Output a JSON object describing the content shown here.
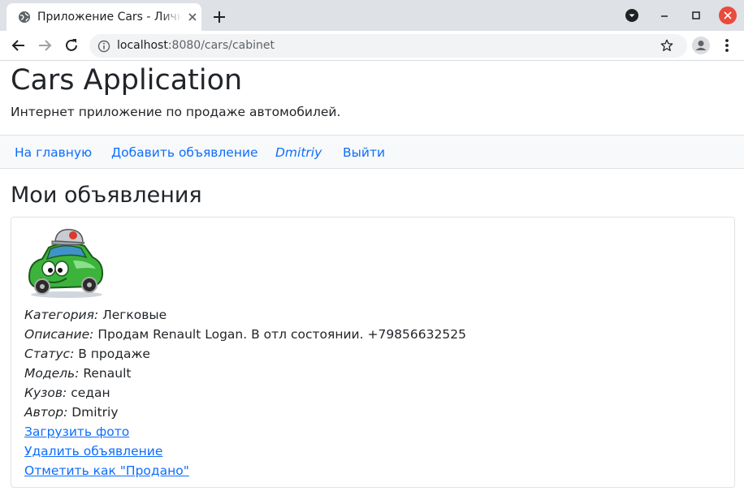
{
  "browser": {
    "tab_title": "Приложение Cars - Личный кабинет",
    "url_host": "localhost",
    "url_rest": ":8080/cars/cabinet"
  },
  "icons": {
    "favicon": "globe-icon",
    "tab_close": "close-icon",
    "new_tab": "plus-icon",
    "back": "arrow-left-icon",
    "forward": "arrow-right-icon",
    "reload": "reload-icon",
    "site_info": "info-icon",
    "bookmark": "star-icon",
    "profile": "profile-icon",
    "menu": "kebab-menu-icon"
  },
  "header": {
    "title": "Cars Application",
    "lead": "Интернет приложение по продаже автомобилей."
  },
  "nav": {
    "home": "На главную",
    "add": "Добавить объявление",
    "user": "Dmitriy",
    "logout": "Выйти"
  },
  "section": {
    "title": "Мои объявления"
  },
  "listing": {
    "fields": [
      {
        "label": "Категория:",
        "value": "Легковые"
      },
      {
        "label": "Описание:",
        "value": "Продам Renault Logan. В отл состоянии. +79856632525"
      },
      {
        "label": "Статус:",
        "value": "В продаже"
      },
      {
        "label": "Модель:",
        "value": "Renault"
      },
      {
        "label": "Кузов:",
        "value": "седан"
      },
      {
        "label": "Автор:",
        "value": "Dmitriy"
      }
    ],
    "links": {
      "upload": "Загрузить фото",
      "delete": "Удалить объявление",
      "mark_sold": "Отметить как \"Продано\""
    }
  },
  "colors": {
    "link": "#0d6efd",
    "navbar_bg": "#f8f9fa",
    "chrome_bg": "#dee1e6",
    "close_window": "#e94b3c"
  }
}
